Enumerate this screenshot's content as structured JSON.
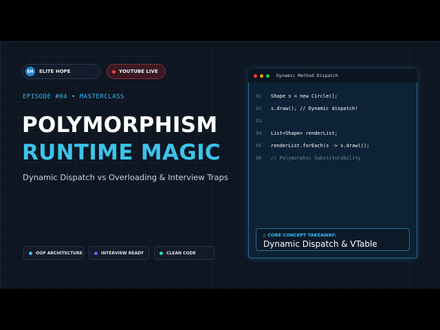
{
  "brand": {
    "logo_text": "EH",
    "name": "ELITE HOPE"
  },
  "live_badge": {
    "label": "YOUTUBE LIVE",
    "dot_color": "#ef4444"
  },
  "episode_line": "EPISODE #04 • MASTERCLASS",
  "title_line1": "POLYMORPHISM",
  "title_line2": "RUNTIME MAGIC",
  "subtitle": "Dynamic Dispatch vs Overloading & Interview Traps",
  "tags": [
    {
      "label": "OOP ARCHITECTURE",
      "dot_color": "#38bdf8"
    },
    {
      "label": "INTERVIEW READY",
      "dot_color": "#6366f1"
    },
    {
      "label": "CLEAN CODE",
      "dot_color": "#2dd4bf"
    }
  ],
  "code_window": {
    "title": "Dynamic Method Dispatch",
    "window_dots": [
      "#ef4444",
      "#f59e0b",
      "#22c55e"
    ],
    "lines": [
      {
        "num": "01",
        "code": "Shape s = new Circle();"
      },
      {
        "num": "02",
        "code": "s.draw(); // Dynamic dispatch!"
      },
      {
        "num": "03",
        "code": ""
      },
      {
        "num": "04",
        "code": "List<Shape> renderList;"
      },
      {
        "num": "05",
        "code": "renderList.forEach(s -> s.draw());"
      },
      {
        "num": "06",
        "code": "// Polymorphic Substitutability"
      }
    ],
    "takeaway": {
      "icon": "lightbulb-icon",
      "icon_glyph": "▯",
      "label": "CORE CONCEPT TAKEAWAY:",
      "value": "Dynamic Dispatch & VTable"
    }
  },
  "colors": {
    "accent": "#38bdf8",
    "title_accent": "#3cc3ea",
    "background": "#0e1622"
  }
}
